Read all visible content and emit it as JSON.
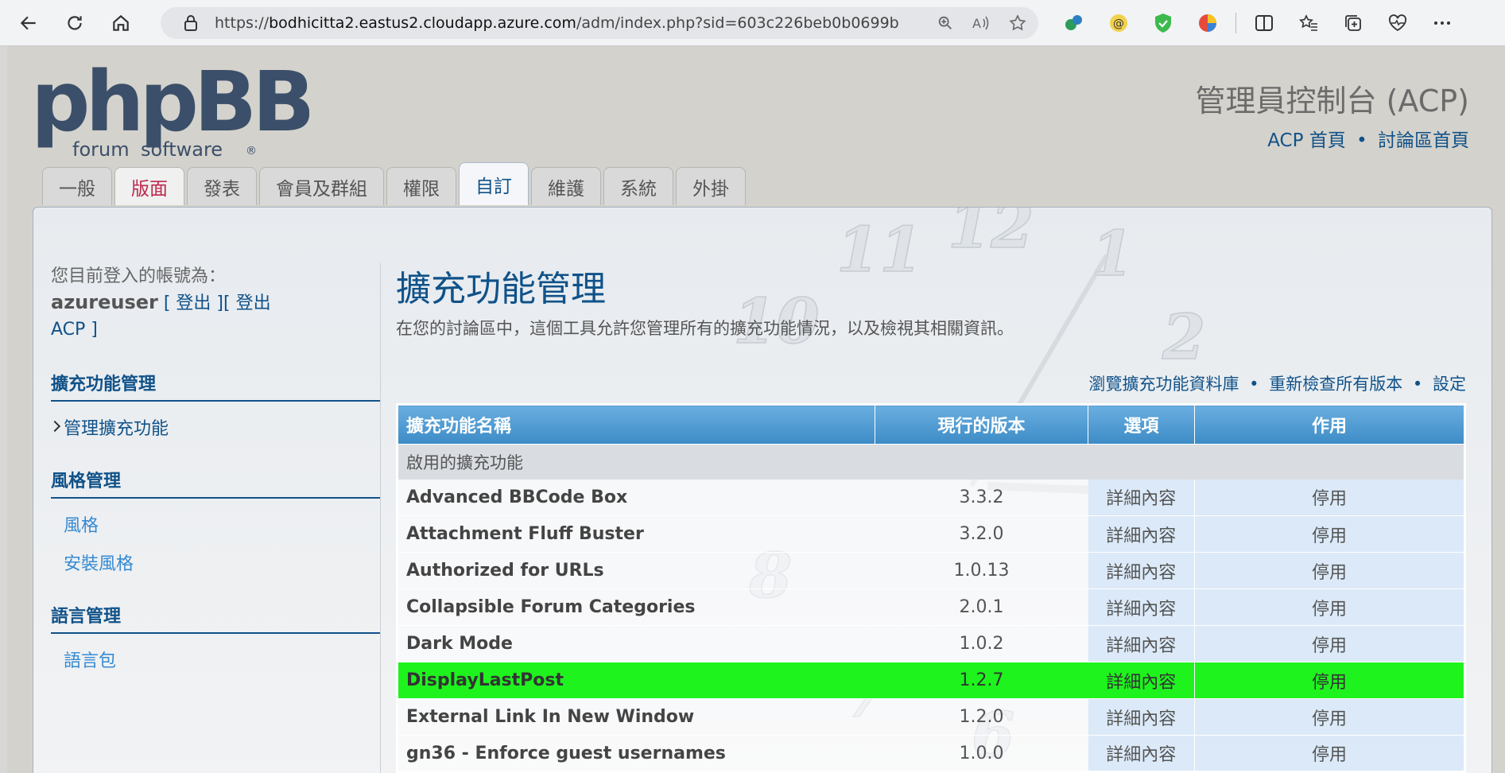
{
  "browser": {
    "url_prefix": "https://",
    "url_host": "bodhicitta2.eastus2.cloudapp.azure.com",
    "url_path": "/adm/index.php?sid=603c226beb0b0699b563832c3..."
  },
  "header": {
    "logo_text": "phpBB",
    "logo_sub1": "forum",
    "logo_sub2": "software",
    "acp_title": "管理員控制台 (ACP)",
    "acp_home": "ACP 首頁",
    "board_home": "討論區首頁",
    "sep": "•"
  },
  "tabs": [
    {
      "label": "一般"
    },
    {
      "label": "版面"
    },
    {
      "label": "發表"
    },
    {
      "label": "會員及群組"
    },
    {
      "label": "權限"
    },
    {
      "label": "自訂"
    },
    {
      "label": "維護"
    },
    {
      "label": "系統"
    },
    {
      "label": "外掛"
    }
  ],
  "sidebar": {
    "login_prefix": "您目前登入的帳號為：",
    "username": "azureuser",
    "logout": "[ 登出 ]",
    "logout_acp": "[ 登出 ACP ]",
    "sections": [
      {
        "title": "擴充功能管理",
        "items": [
          "管理擴充功能"
        ]
      },
      {
        "title": "風格管理",
        "items": [
          "風格",
          "安裝風格"
        ]
      },
      {
        "title": "語言管理",
        "items": [
          "語言包"
        ]
      }
    ]
  },
  "main": {
    "title": "擴充功能管理",
    "description": "在您的討論區中，這個工具允許您管理所有的擴充功能情況，以及檢視其相關資訊。",
    "links": [
      "瀏覽擴充功能資料庫",
      "重新檢查所有版本",
      "設定"
    ],
    "sep": "•",
    "table": {
      "headers": [
        "擴充功能名稱",
        "現行的版本",
        "選項",
        "作用"
      ],
      "group": "啟用的擴充功能",
      "rows": [
        {
          "name": "Advanced BBCode Box",
          "version": "3.3.2",
          "option": "詳細內容",
          "action": "停用"
        },
        {
          "name": "Attachment Fluff Buster",
          "version": "3.2.0",
          "option": "詳細內容",
          "action": "停用"
        },
        {
          "name": "Authorized for URLs",
          "version": "1.0.13",
          "option": "詳細內容",
          "action": "停用"
        },
        {
          "name": "Collapsible Forum Categories",
          "version": "2.0.1",
          "option": "詳細內容",
          "action": "停用"
        },
        {
          "name": "Dark Mode",
          "version": "1.0.2",
          "option": "詳細內容",
          "action": "停用"
        },
        {
          "name": "DisplayLastPost",
          "version": "1.2.7",
          "option": "詳細內容",
          "action": "停用"
        },
        {
          "name": "External Link In New Window",
          "version": "1.2.0",
          "option": "詳細內容",
          "action": "停用"
        },
        {
          "name": "gn36 - Enforce guest usernames",
          "version": "1.0.0",
          "option": "詳細內容",
          "action": "停用"
        }
      ]
    }
  },
  "colors": {
    "link": "#105289",
    "highlight_row": "#1ef31e",
    "header_blue": "#4a95cf"
  }
}
